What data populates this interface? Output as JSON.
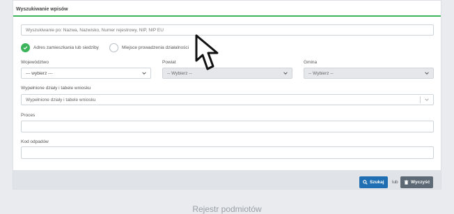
{
  "panel": {
    "title": "Wyszukiwanie wpisów"
  },
  "search": {
    "placeholder": "Wyszukiwanie po: Nazwa, Nazwisko, Numer rejestrowy, NIP, NIP EU"
  },
  "address_options": [
    {
      "label": "Adres zamieszkania lub siedziby",
      "selected": true
    },
    {
      "label": "Miejsce prowadzenia działalności",
      "selected": false
    }
  ],
  "filters": {
    "wojewodztwo": {
      "label": "Województwo",
      "value": "--- wybierz ---"
    },
    "powiat": {
      "label": "Powiat",
      "value": "-- Wybierz --"
    },
    "gmina": {
      "label": "Gmina",
      "value": "-- Wybierz --"
    }
  },
  "sections": {
    "label": "Wypełnione działy i tabele wniosku",
    "placeholder": "Wypełnione działy i tabele wniosku"
  },
  "proces": {
    "label": "Proces",
    "value": ""
  },
  "kod_odpadow": {
    "label": "Kod odpadów",
    "value": ""
  },
  "actions": {
    "search_label": "Szukaj",
    "or_label": "lub",
    "clear_label": "Wyczyść"
  },
  "below": {
    "title": "Rejestr podmiotów"
  },
  "colors": {
    "accent_green": "#3cb45a",
    "primary_blue": "#1f6fb2",
    "secondary_gray": "#5d6975"
  },
  "icons": [
    "check-icon",
    "chevron-down-icon",
    "search-icon",
    "trash-icon",
    "arrow-cursor-icon"
  ]
}
